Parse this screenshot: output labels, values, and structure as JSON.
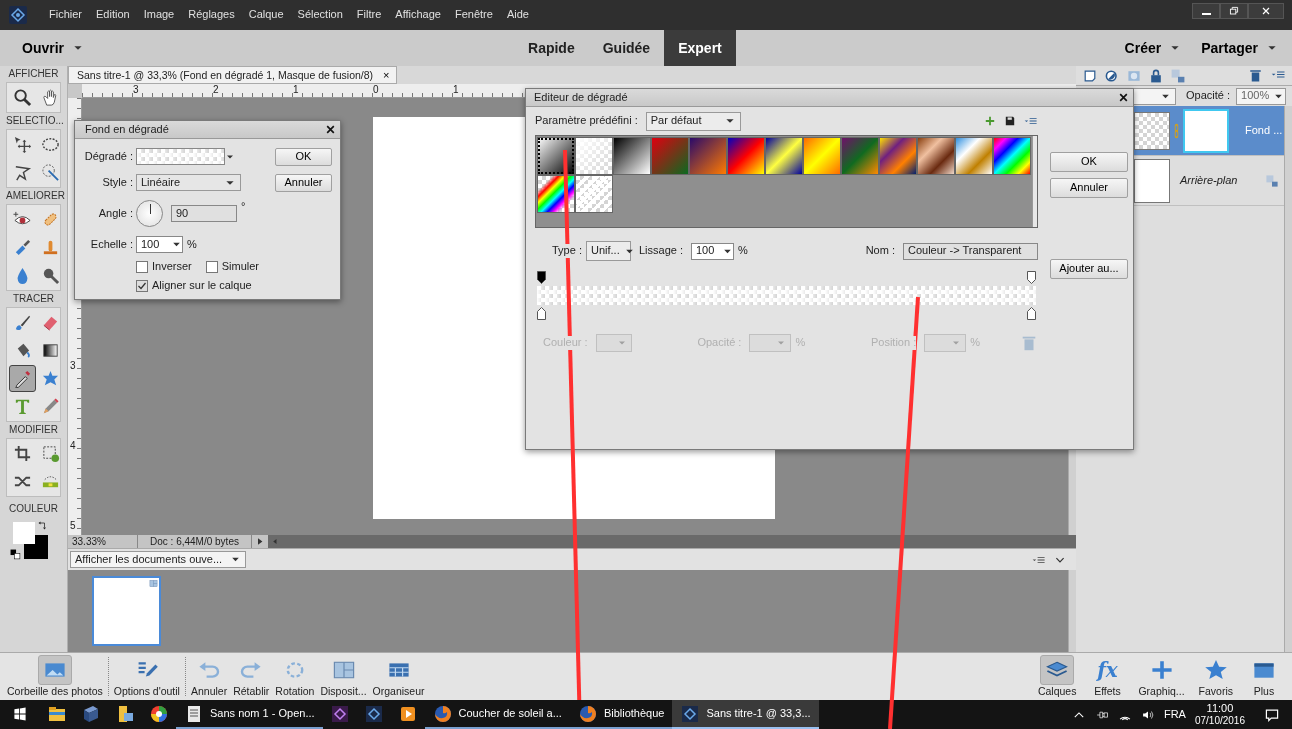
{
  "menu_bar": {
    "items": [
      "Fichier",
      "Edition",
      "Image",
      "Réglages",
      "Calque",
      "Sélection",
      "Filtre",
      "Affichage",
      "Fenêtre",
      "Aide"
    ]
  },
  "mode_bar": {
    "open": "Ouvrir",
    "modes": [
      {
        "label": "Rapide",
        "selected": false
      },
      {
        "label": "Guidée",
        "selected": false
      },
      {
        "label": "Expert",
        "selected": true
      }
    ],
    "actions": [
      "Créer",
      "Partager"
    ]
  },
  "toolbox": {
    "sections": [
      {
        "title": "AFFICHER",
        "tools": [
          {
            "kind": "zoom",
            "selected": false
          },
          {
            "kind": "hand",
            "selected": false
          }
        ]
      },
      {
        "title": "SELECTIO...",
        "tools": [
          {
            "kind": "move",
            "selected": false
          },
          {
            "kind": "ellipse",
            "selected": false
          },
          {
            "kind": "lasso",
            "selected": false
          },
          {
            "kind": "wand",
            "selected": false
          }
        ]
      },
      {
        "title": "AMELIORER",
        "tools": [
          {
            "kind": "redeye",
            "selected": false
          },
          {
            "kind": "bandage",
            "selected": false
          },
          {
            "kind": "smartbrush",
            "selected": false
          },
          {
            "kind": "stamp",
            "selected": false
          },
          {
            "kind": "drop",
            "selected": false
          },
          {
            "kind": "magnifier",
            "selected": false
          }
        ]
      },
      {
        "title": "TRACER",
        "tools": [
          {
            "kind": "brush",
            "selected": false
          },
          {
            "kind": "eraser",
            "selected": false
          },
          {
            "kind": "bucket",
            "selected": false
          },
          {
            "kind": "gradient",
            "selected": false
          },
          {
            "kind": "eyedropper",
            "selected": true
          },
          {
            "kind": "shape",
            "selected": false
          },
          {
            "kind": "type",
            "selected": false
          },
          {
            "kind": "pencil",
            "selected": false
          }
        ]
      },
      {
        "title": "MODIFIER",
        "tools": [
          {
            "kind": "crop",
            "selected": false
          },
          {
            "kind": "recompose",
            "selected": false
          },
          {
            "kind": "shuffle",
            "selected": false
          },
          {
            "kind": "level",
            "selected": false
          }
        ]
      }
    ],
    "color_title": "COULEUR"
  },
  "document": {
    "tab": "Sans titre-1 @ 33,3% (Fond en dégradé 1, Masque de fusion/8)",
    "close": "×",
    "h_ruler": [
      "3",
      "2",
      "1",
      "0",
      "1"
    ],
    "v_ruler": [
      "3",
      "4",
      "5"
    ],
    "zoom": "33.33%",
    "doc_info": "Doc : 6,44M/0 bytes"
  },
  "photo_bin": {
    "dropdown": "Afficher les documents ouve..."
  },
  "layers_panel": {
    "opacity_label": "Opacité :",
    "opacity": "100%",
    "layers": [
      {
        "name": "Fond ...",
        "kind": "fill",
        "selected": true
      },
      {
        "name": "Arrière-plan",
        "kind": "background",
        "selected": false
      }
    ]
  },
  "gradient_fill_dialog": {
    "title": "Fond en dégradé",
    "gradient_label": "Dégradé :",
    "style_label": "Style :",
    "style": "Linéaire",
    "angle_label": "Angle :",
    "angle": "90",
    "degree": "°",
    "scale_label": "Echelle :",
    "scale": "100",
    "percent": "%",
    "options": [
      {
        "label": "Inverser",
        "checked": false
      },
      {
        "label": "Simuler",
        "checked": false
      },
      {
        "label": "Aligner sur le calque",
        "checked": true
      }
    ],
    "buttons": [
      "OK",
      "Annuler"
    ]
  },
  "gradient_editor": {
    "title": "Editeur de dégradé",
    "preset_label": "Paramètre prédéfini :",
    "preset": "Par défaut",
    "presets": [
      {
        "selected": true
      },
      {
        "selected": false
      },
      {
        "selected": false
      },
      {
        "selected": false
      },
      {
        "selected": false
      },
      {
        "selected": false
      },
      {
        "selected": false
      },
      {
        "selected": false
      },
      {
        "selected": false
      },
      {
        "selected": false
      },
      {
        "selected": false
      },
      {
        "selected": false
      },
      {
        "selected": false
      },
      {
        "selected": false
      },
      {
        "selected": false
      }
    ],
    "buttons": [
      "OK",
      "Annuler"
    ],
    "type_label": "Type :",
    "type": "Unif...",
    "smoothness_label": "Lissage :",
    "smoothness": "100",
    "percent": "%",
    "name_label": "Nom :",
    "name": "Couleur -> Transparent",
    "add_button": "Ajouter au...",
    "stop_editor": {
      "disabled": true,
      "fields": [
        {
          "label": "Couleur :"
        },
        {
          "label": "Opacité :",
          "unit": "%"
        },
        {
          "label": "Position :",
          "unit": "%"
        }
      ]
    }
  },
  "bottom_bar": {
    "left": [
      {
        "kind": "photos",
        "label": "Corbeille des photos",
        "selected": true
      },
      {
        "kind": "options",
        "label": "Options d'outil",
        "selected": false
      },
      {
        "kind": "undo",
        "label": "Annuler",
        "selected": false
      },
      {
        "kind": "redo",
        "label": "Rétablir",
        "selected": false
      },
      {
        "kind": "rotate",
        "label": "Rotation",
        "selected": false
      },
      {
        "kind": "layout",
        "label": "Disposit...",
        "selected": false
      },
      {
        "kind": "organizer",
        "label": "Organiseur",
        "selected": false
      }
    ],
    "right": [
      {
        "kind": "layers",
        "label": "Calques",
        "selected": true
      },
      {
        "kind": "fx",
        "glyph": "fx",
        "label": "Effets",
        "selected": false
      },
      {
        "kind": "plus",
        "label": "Graphiq...",
        "selected": false
      },
      {
        "kind": "star",
        "label": "Favoris",
        "selected": false
      },
      {
        "kind": "window",
        "label": "Plus",
        "selected": false
      }
    ]
  },
  "taskbar": {
    "items": [
      {
        "kind": "folder",
        "selected": false
      },
      {
        "kind": "book",
        "selected": false
      },
      {
        "kind": "files",
        "selected": false
      },
      {
        "kind": "wheel",
        "selected": false
      },
      {
        "kind": "writer",
        "label": "Sans nom 1 - Open...",
        "selected": false
      },
      {
        "kind": "premiere",
        "selected": false
      },
      {
        "kind": "elements",
        "selected": false
      },
      {
        "kind": "media",
        "selected": false
      },
      {
        "kind": "globe",
        "label": "Coucher de soleil a...",
        "selected": false
      },
      {
        "kind": "globe",
        "label": "Bibliothèque",
        "selected": false
      },
      {
        "kind": "elements",
        "label": "Sans titre-1 @ 33,3...",
        "selected": true
      }
    ],
    "language": "FRA",
    "time": "11:00",
    "date": "07/10/2016"
  }
}
